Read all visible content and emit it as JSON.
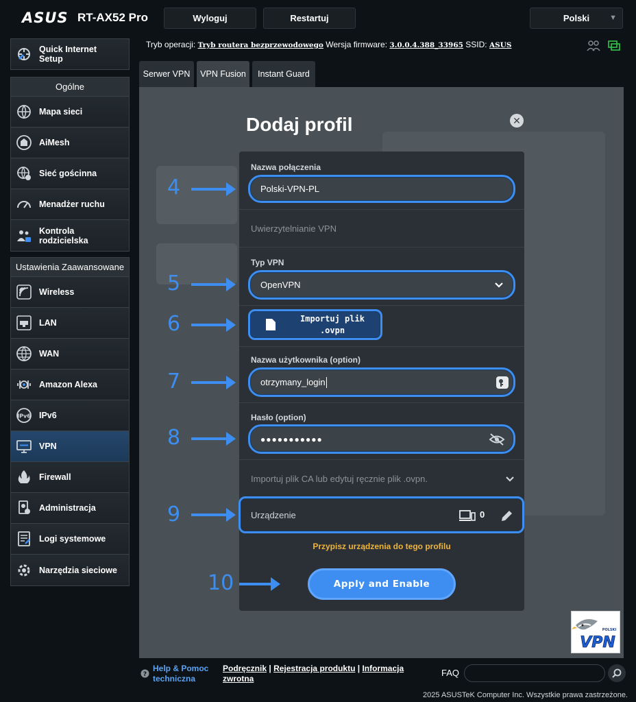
{
  "header": {
    "logo": "ASUS",
    "model": "RT-AX52 Pro",
    "logout_label": "Wyloguj",
    "restart_label": "Restartuj",
    "language": "Polski",
    "op_mode_label": "Tryb operacji:",
    "op_mode_value": "Tryb routera bezprzewodowego",
    "firmware_label": "Wersja firmware:",
    "firmware_value": "3.0.0.4.388_33965",
    "ssid_label": "SSID:",
    "ssid_value": "ASUS"
  },
  "sidebar": {
    "quick_setup": "Quick Internet Setup",
    "general_header": "Ogólne",
    "general_items": [
      {
        "label": "Mapa sieci",
        "icon": "globe-map-icon"
      },
      {
        "label": "AiMesh",
        "icon": "mesh-icon"
      },
      {
        "label": "Sieć gościnna",
        "icon": "guest-network-icon"
      },
      {
        "label": "Menadżer ruchu",
        "icon": "gauge-icon"
      },
      {
        "label": "Kontrola rodzicielska",
        "icon": "parental-icon"
      }
    ],
    "advanced_header": "Ustawienia Zaawansowane",
    "advanced_items": [
      {
        "label": "Wireless",
        "icon": "wifi-icon"
      },
      {
        "label": "LAN",
        "icon": "lan-icon"
      },
      {
        "label": "WAN",
        "icon": "globe-icon"
      },
      {
        "label": "Amazon Alexa",
        "icon": "alexa-icon"
      },
      {
        "label": "IPv6",
        "icon": "ipv6-icon"
      },
      {
        "label": "VPN",
        "icon": "vpn-icon"
      },
      {
        "label": "Firewall",
        "icon": "fire-icon"
      },
      {
        "label": "Administracja",
        "icon": "admin-icon"
      },
      {
        "label": "Logi systemowe",
        "icon": "log-icon"
      },
      {
        "label": "Narzędzia sieciowe",
        "icon": "tools-icon"
      }
    ]
  },
  "tabs": [
    {
      "label": "Serwer VPN"
    },
    {
      "label": "VPN Fusion"
    },
    {
      "label": "Instant Guard"
    }
  ],
  "modal": {
    "title": "Dodaj profil",
    "conn_name_label": "Nazwa połączenia",
    "conn_name_value": "Polski-VPN-PL",
    "auth_label": "Uwierzytelnianie VPN",
    "vpn_type_label": "Typ VPN",
    "vpn_type_value": "OpenVPN",
    "import_btn_line1": "Importuj plik",
    "import_btn_line2": ".ovpn",
    "username_label": "Nazwa użytkownika (option)",
    "username_value": "otrzymany_login",
    "password_label": "Hasło (option)",
    "password_value": "●●●●●●●●●●●",
    "import_ca_label": "Importuj plik CA lub edytuj ręcznie plik .ovpn.",
    "device_label": "Urządzenie",
    "device_count": "0",
    "assign_text": "Przypisz urządzenia do tego profilu",
    "apply_label": "Apply and Enable"
  },
  "steps": [
    "4",
    "5",
    "6",
    "7",
    "8",
    "9",
    "10"
  ],
  "footer": {
    "help_line1": "Help & Pomoc",
    "help_line2": "techniczna",
    "link_manual": "Podręcznik",
    "link_register": "Rejestracja produktu",
    "link_feedback_1": "Informacja",
    "link_feedback_2": "zwrotna",
    "faq_label": "FAQ",
    "copyright": "2025 ASUSTeK Computer Inc. Wszystkie prawa zastrzeżone."
  },
  "badge": {
    "text": "VPN",
    "small": "POLSKI"
  },
  "colors": {
    "accent": "#3d8ef0",
    "warning": "#f0b43a",
    "bg": "#0d1216"
  }
}
